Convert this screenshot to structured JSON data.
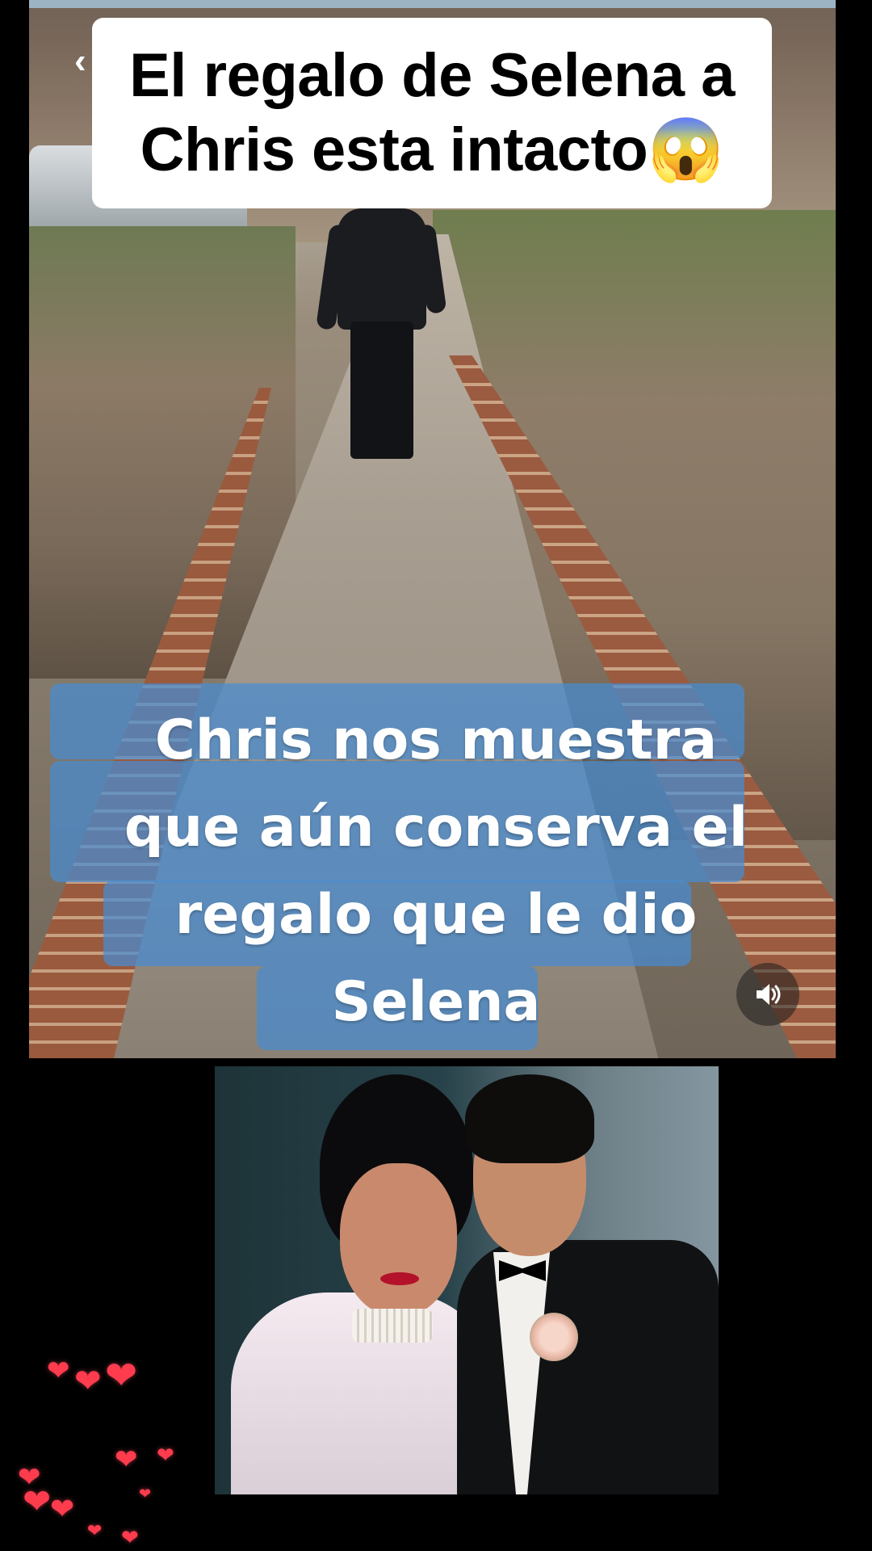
{
  "title_caption": {
    "line1": "El regalo de Selena a",
    "line2": "Chris esta intacto😱"
  },
  "subtitles": {
    "line1": "Chris nos muestra",
    "line2": "que aún conserva el",
    "line3": "regalo que le dio",
    "line4": "Selena"
  },
  "controls": {
    "back_icon": "chevron-left-icon",
    "sound_icon": "speaker-icon",
    "back_glyph": "‹",
    "sound_glyph": "🔊"
  },
  "decor": {
    "heart_glyph": "❤"
  },
  "colors": {
    "subtitle_box": "#468cd2",
    "caption_bg": "#ffffff",
    "hearts": "#ff3b4e",
    "background": "#000000"
  }
}
